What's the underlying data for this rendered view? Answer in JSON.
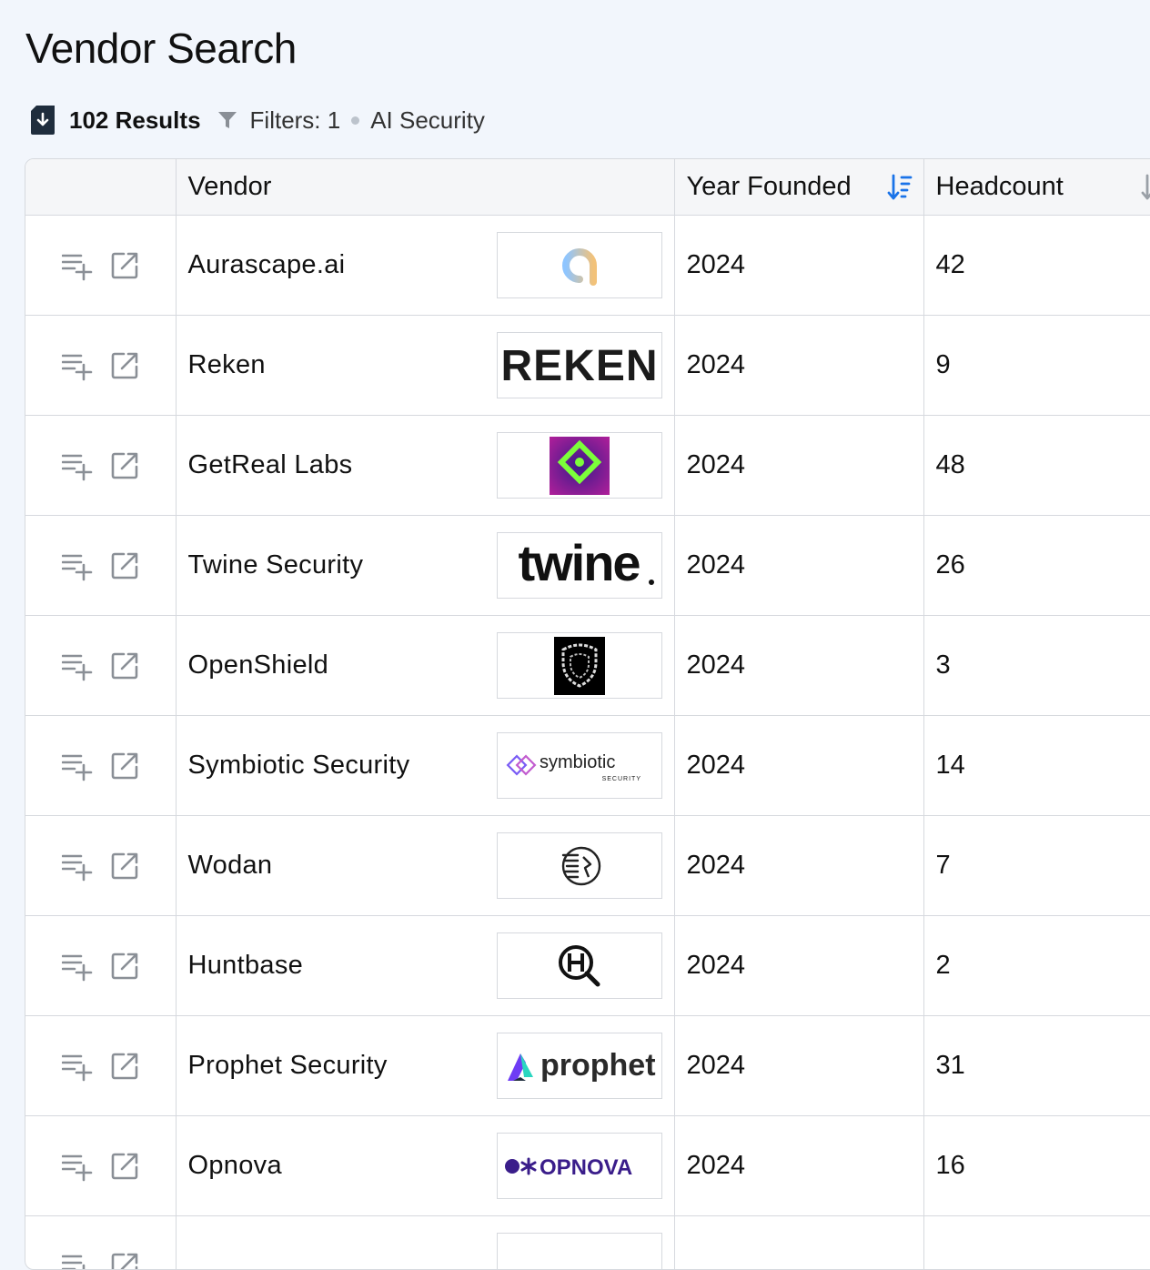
{
  "page": {
    "title": "Vendor Search"
  },
  "toolbar": {
    "results": "102 Results",
    "filters_label": "Filters: 1",
    "filter_value": "AI Security"
  },
  "table": {
    "columns": {
      "vendor": "Vendor",
      "year": "Year Founded",
      "headcount": "Headcount"
    },
    "rows": [
      {
        "vendor": "Aurascape.ai",
        "year": "2024",
        "headcount": "42",
        "logo": "aurascape-logo"
      },
      {
        "vendor": "Reken",
        "year": "2024",
        "headcount": "9",
        "logo": "reken-logo",
        "logo_text": "REKEN"
      },
      {
        "vendor": "GetReal Labs",
        "year": "2024",
        "headcount": "48",
        "logo": "getreal-logo"
      },
      {
        "vendor": "Twine Security",
        "year": "2024",
        "headcount": "26",
        "logo": "twine-logo",
        "logo_text": "twine"
      },
      {
        "vendor": "OpenShield",
        "year": "2024",
        "headcount": "3",
        "logo": "openshield-logo"
      },
      {
        "vendor": "Symbiotic Security",
        "year": "2024",
        "headcount": "14",
        "logo": "symbiotic-logo",
        "logo_text": "symbiotic",
        "logo_subtext": "SECURITY"
      },
      {
        "vendor": "Wodan",
        "year": "2024",
        "headcount": "7",
        "logo": "wodan-logo"
      },
      {
        "vendor": "Huntbase",
        "year": "2024",
        "headcount": "2",
        "logo": "huntbase-logo"
      },
      {
        "vendor": "Prophet Security",
        "year": "2024",
        "headcount": "31",
        "logo": "prophet-logo",
        "logo_text": "prophet"
      },
      {
        "vendor": "Opnova",
        "year": "2024",
        "headcount": "16",
        "logo": "opnova-logo",
        "logo_text": "OPNOVA"
      }
    ]
  },
  "colors": {
    "accent": "#1a73e8",
    "icon_gray": "#8a8f96",
    "border": "#d6d9de",
    "background": "#f2f6fc"
  }
}
